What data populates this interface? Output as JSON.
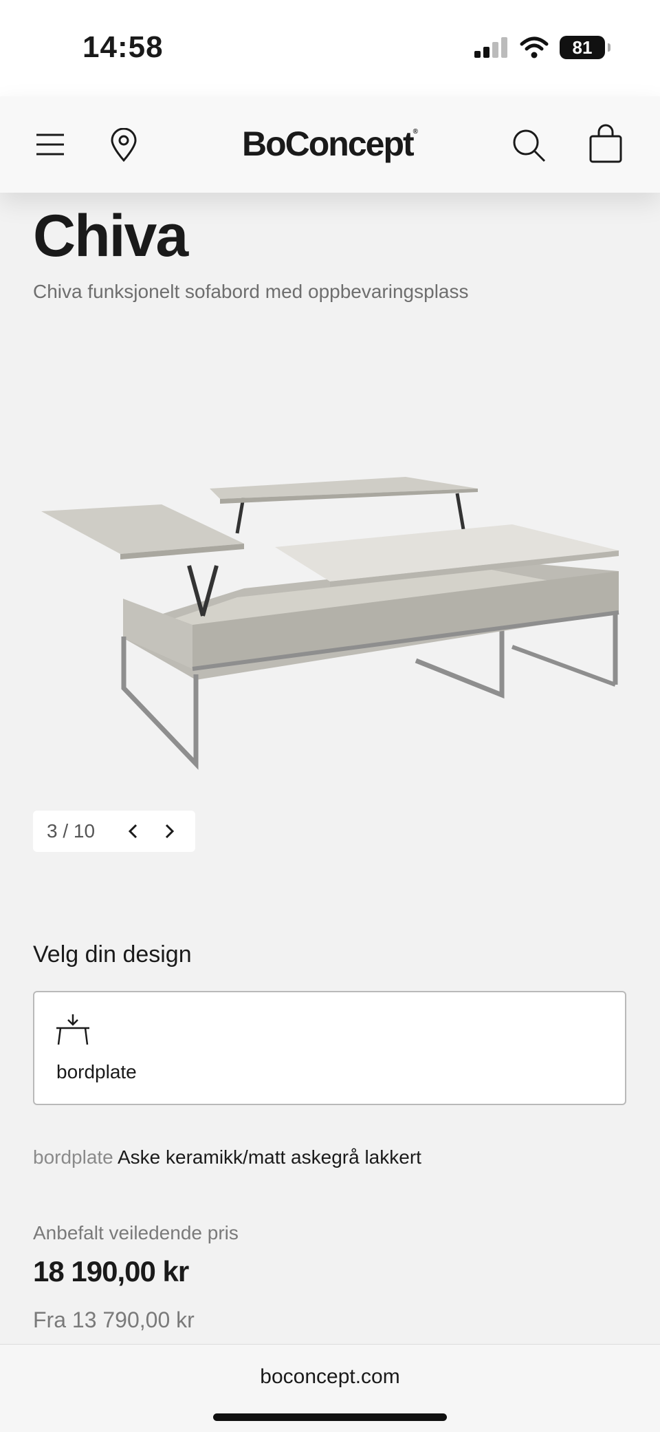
{
  "status_bar": {
    "time": "14:58",
    "battery": "81",
    "icons": [
      "signal-icon",
      "wifi-icon",
      "battery-icon"
    ]
  },
  "header": {
    "logo": "BoConcept",
    "logo_mark": "®",
    "icons": [
      "menu-icon",
      "location-pin-icon",
      "search-icon",
      "shopping-bag-icon"
    ]
  },
  "product": {
    "title": "Chiva",
    "subtitle": "Chiva funksjonelt sofabord med oppbevaringsplass"
  },
  "gallery": {
    "counter": "3 / 10",
    "icons": [
      "chevron-left-icon",
      "chevron-right-icon"
    ]
  },
  "design": {
    "heading": "Velg din design",
    "option_label": "bordplate",
    "option_icon": "table-top-icon",
    "selection_key": "bordplate",
    "selection_value": "Aske keramikk/matt askegrå lakkert"
  },
  "pricing": {
    "label": "Anbefalt veiledende pris",
    "price": "18 190,00 kr",
    "from": "Fra 13 790,00 kr"
  },
  "browser": {
    "url": "boconcept.com"
  },
  "colors": {
    "background": "#f2f2f2",
    "text": "#1a1a1a",
    "muted": "#7a7a7a",
    "table_top": "#cfcdc6",
    "table_frame": "#8e8e8e"
  }
}
